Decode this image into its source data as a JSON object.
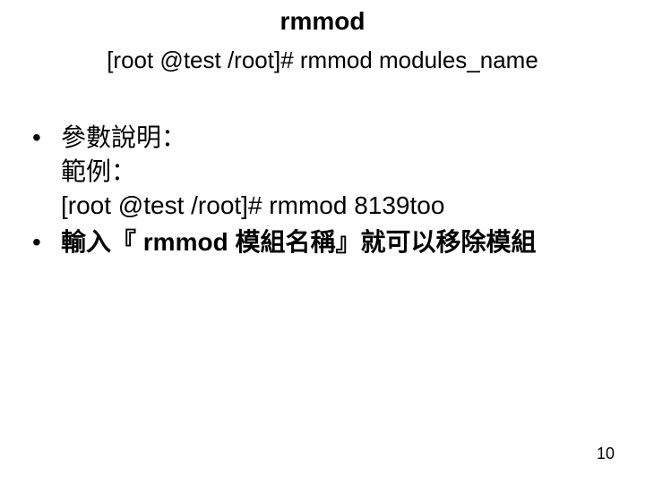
{
  "title": "rmmod",
  "subtitle": "[root @test /root]# rmmod modules_name",
  "bullets": [
    {
      "lines": [
        "參數說明：",
        "範例：",
        "[root @test /root]# rmmod 8139too"
      ],
      "bold": false
    },
    {
      "lines": [
        "輸入『 rmmod 模組名稱』就可以移除模組"
      ],
      "bold": true
    }
  ],
  "page_number": "10"
}
